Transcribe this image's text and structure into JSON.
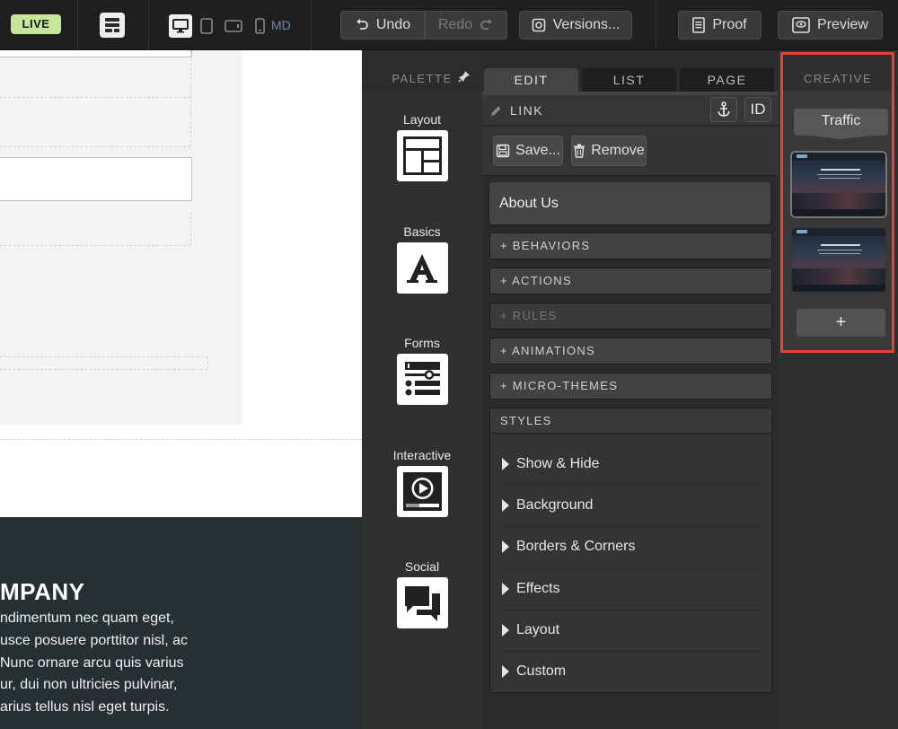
{
  "topbar": {
    "live_badge": "LIVE",
    "device_label": "MD",
    "undo_label": "Undo",
    "redo_label": "Redo",
    "versions_label": "Versions...",
    "proof_label": "Proof",
    "preview_label": "Preview"
  },
  "canvas": {
    "heading": "MPANY",
    "paragraph_lines": [
      "ndimentum nec quam eget,",
      "usce posuere porttitor nisl, ac",
      "Nunc ornare arcu quis varius",
      "ur, dui non ultricies pulvinar,",
      "arius tellus nisl eget turpis."
    ]
  },
  "palette": {
    "title": "PALETTE",
    "items": [
      {
        "label": "Layout",
        "icon": "layout-icon"
      },
      {
        "label": "Basics",
        "icon": "text-a-icon"
      },
      {
        "label": "Forms",
        "icon": "form-icon"
      },
      {
        "label": "Interactive",
        "icon": "play-icon"
      },
      {
        "label": "Social",
        "icon": "chat-icon"
      }
    ]
  },
  "edit_panel": {
    "tabs": [
      "EDIT",
      "LIST",
      "PAGE"
    ],
    "active_tab": "EDIT",
    "element_type": "LINK",
    "id_button": "ID",
    "save_label": "Save...",
    "remove_label": "Remove",
    "link_text": "About Us",
    "sections": [
      "+ BEHAVIORS",
      "+ ACTIONS",
      "+ RULES",
      "+ ANIMATIONS",
      "+ MICRO-THEMES"
    ],
    "styles_header": "STYLES",
    "style_items": [
      "Show & Hide",
      "Background",
      "Borders & Corners",
      "Effects",
      "Layout",
      "Custom"
    ]
  },
  "creative": {
    "title": "CREATIVE",
    "traffic_label": "Traffic",
    "add_label": "+",
    "highlight_color": "#e8412c"
  }
}
